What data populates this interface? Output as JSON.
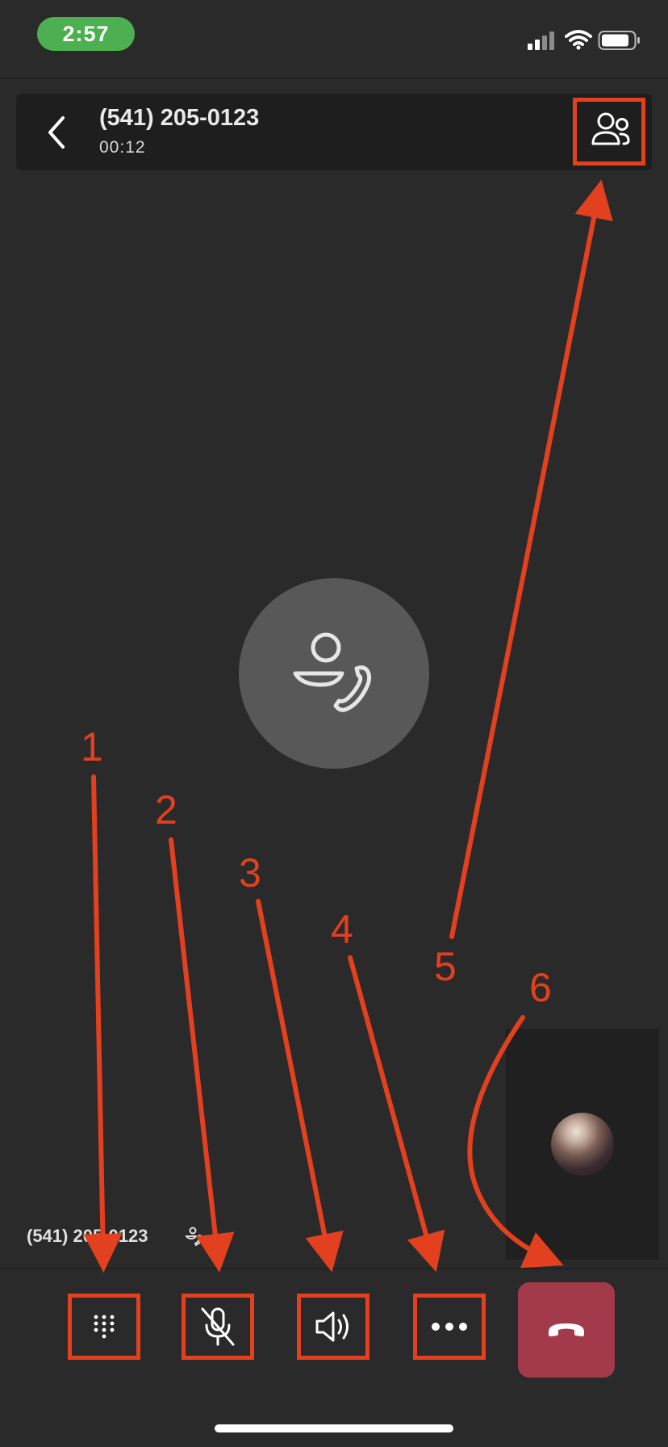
{
  "status_bar": {
    "time": "2:57"
  },
  "header": {
    "caller_number": "(541) 205-0123",
    "call_duration": "00:12"
  },
  "bottom": {
    "caller_number": "(541) 205-0123"
  },
  "controls": [
    "dialpad",
    "mute",
    "speaker",
    "more",
    "end-call"
  ],
  "annotations": {
    "labels": [
      "1",
      "2",
      "3",
      "4",
      "5",
      "6"
    ],
    "color": "#e2401f"
  },
  "colors": {
    "background": "#2b2a2b",
    "time_pill": "#4cb050",
    "end_call": "#a23a4b",
    "avatar": "#595859"
  }
}
